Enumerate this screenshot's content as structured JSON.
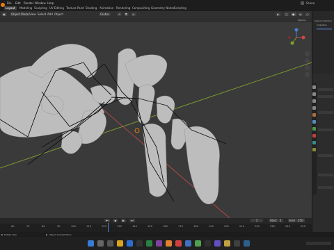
{
  "topbar": {
    "menus": [
      "File",
      "Edit",
      "Render",
      "Window",
      "Help"
    ],
    "tabs": [
      "Layout",
      "Modeling",
      "Sculpting",
      "UV Editing",
      "Texture Paint",
      "Shading",
      "Animation",
      "Rendering",
      "Compositing",
      "Geometry Nodes",
      "Scripting"
    ],
    "active_tab": "Layout",
    "scene_label": "Scene"
  },
  "viewport_header": {
    "mode": "Object Mode",
    "menus": [
      "View",
      "Select",
      "Add",
      "Object"
    ],
    "transform": "Global",
    "options": "Options"
  },
  "gizmo": {
    "x": "X",
    "y": "Y",
    "z": "Z"
  },
  "outliner": {
    "title": "Scene Collection",
    "items": [
      "Collection"
    ]
  },
  "timeline": {
    "frames": [
      "60",
      "70",
      "80",
      "90",
      "100",
      "110",
      "120",
      "130",
      "140",
      "150",
      "160",
      "170",
      "180",
      "190",
      "200",
      "210",
      "220",
      "230",
      "240",
      "250"
    ],
    "current_frame": "1",
    "start_label": "Start",
    "start": "1",
    "end_label": "End",
    "end": "250"
  },
  "statusbar": {
    "left": "Rotate View",
    "middle": "Object Context Menu"
  },
  "colors": {
    "accent": "#4a88e0",
    "axis_x": "#b04848",
    "axis_y": "#7a9a30",
    "selected": "#e87d0d"
  }
}
